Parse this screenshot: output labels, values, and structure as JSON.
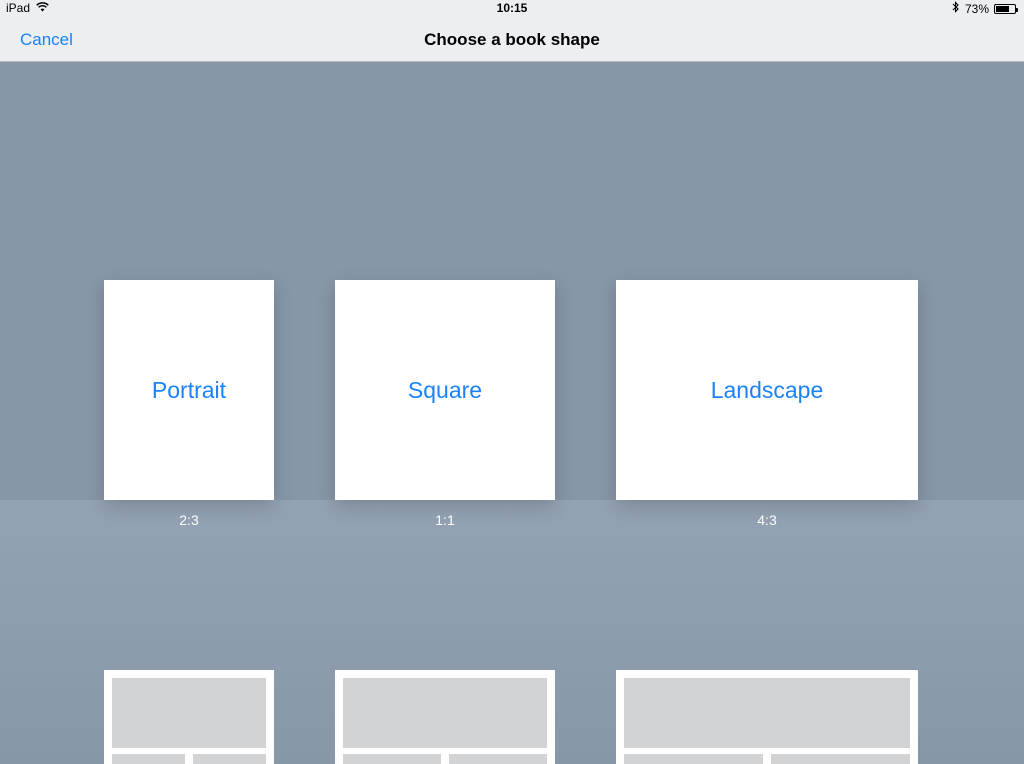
{
  "status_bar": {
    "device": "iPad",
    "time": "10:15",
    "battery_percent": "73%",
    "battery_level": 0.73,
    "icons": [
      "wifi-icon",
      "bluetooth-icon",
      "battery-icon"
    ]
  },
  "nav": {
    "cancel_label": "Cancel",
    "title": "Choose a book shape"
  },
  "shapes": [
    {
      "label": "Portrait",
      "ratio": "2:3"
    },
    {
      "label": "Square",
      "ratio": "1:1"
    },
    {
      "label": "Landscape",
      "ratio": "4:3"
    }
  ],
  "colors": {
    "accent": "#1a82fb",
    "background": "#8797a8",
    "bar": "#eceef1",
    "placeholder": "#d2d3d5"
  }
}
